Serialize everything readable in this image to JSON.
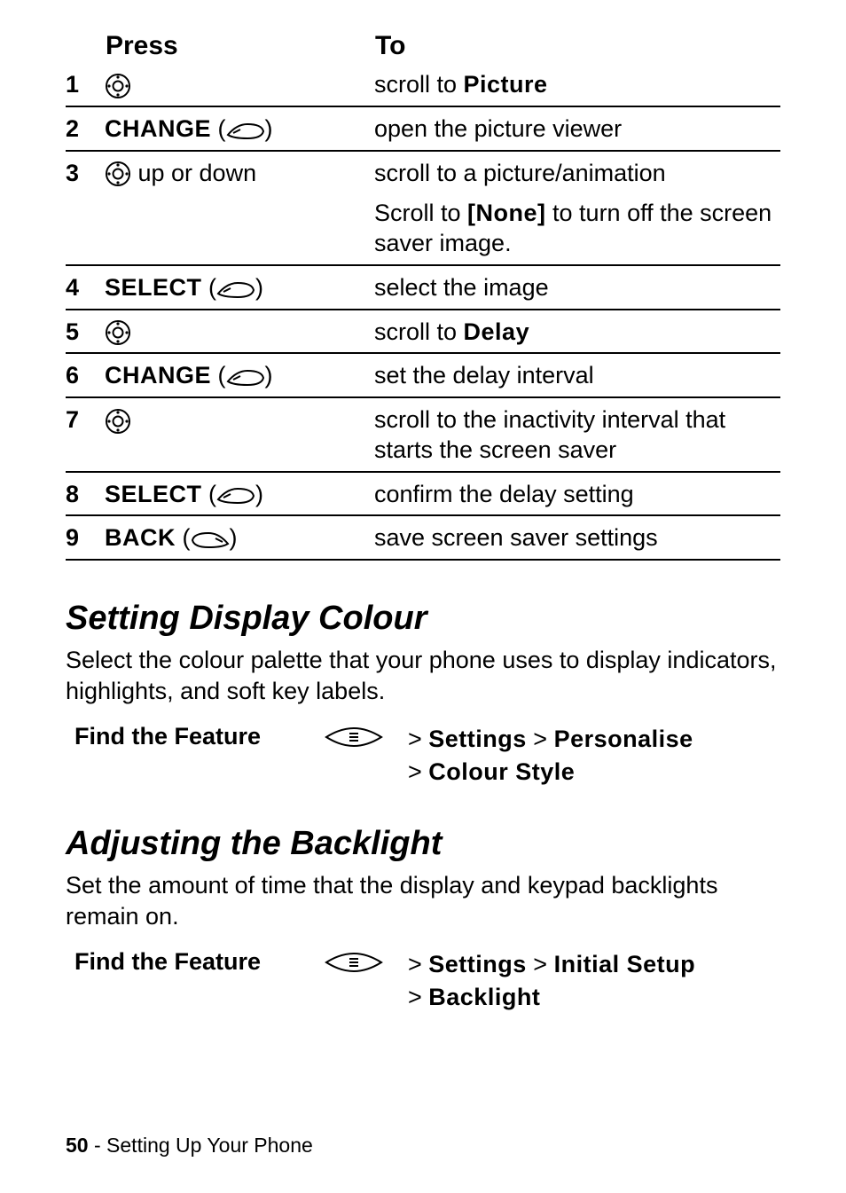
{
  "table": {
    "headers": {
      "press": "Press",
      "to": "To"
    },
    "rows": [
      {
        "n": "1",
        "press_label": "",
        "press_suffix": "",
        "to": "scroll to ",
        "to_bold": "Picture"
      },
      {
        "n": "2",
        "press_label": "CHANGE",
        "press_suffix": "",
        "to": "open the picture viewer"
      },
      {
        "n": "3",
        "press_label": "",
        "press_suffix": " up or down",
        "to": "scroll to a picture/animation"
      },
      {
        "n": "",
        "press_label": "",
        "press_suffix": "",
        "to_prefix": "Scroll to ",
        "to_bold": "[None]",
        "to_suffix": " to turn off the screen saver image."
      },
      {
        "n": "4",
        "press_label": "SELECT",
        "press_suffix": "",
        "to": "select the image"
      },
      {
        "n": "5",
        "press_label": "",
        "press_suffix": "",
        "to": "scroll to ",
        "to_bold": "Delay"
      },
      {
        "n": "6",
        "press_label": "CHANGE",
        "press_suffix": "",
        "to": "set the delay interval"
      },
      {
        "n": "7",
        "press_label": "",
        "press_suffix": "",
        "to": "scroll to the inactivity interval that starts the screen saver"
      },
      {
        "n": "8",
        "press_label": "SELECT",
        "press_suffix": "",
        "to": "confirm the delay setting"
      },
      {
        "n": "9",
        "press_label": "BACK",
        "press_suffix": "",
        "to": "save screen saver settings"
      }
    ]
  },
  "sections": {
    "colour": {
      "title": "Setting Display Colour",
      "para": "Select the colour palette that your phone uses to display indicators, highlights, and soft key labels.",
      "ftf_label": "Find the Feature",
      "path_line1_a": "> ",
      "path_line1_b": "Settings",
      "path_line1_c": " > ",
      "path_line1_d": "Personalise",
      "path_line2_a": "> ",
      "path_line2_b": "Colour Style"
    },
    "backlight": {
      "title": "Adjusting the Backlight",
      "para": "Set the amount of time that the display and keypad backlights remain on.",
      "ftf_label": "Find the Feature",
      "path_a": "> ",
      "path_b": "Settings",
      "path_c": " > ",
      "path_d": "Initial Setup",
      "path_e": " > ",
      "path_f": "Backlight"
    }
  },
  "footer": {
    "page": "50",
    "sep": " - ",
    "section": "Setting Up Your Phone"
  }
}
